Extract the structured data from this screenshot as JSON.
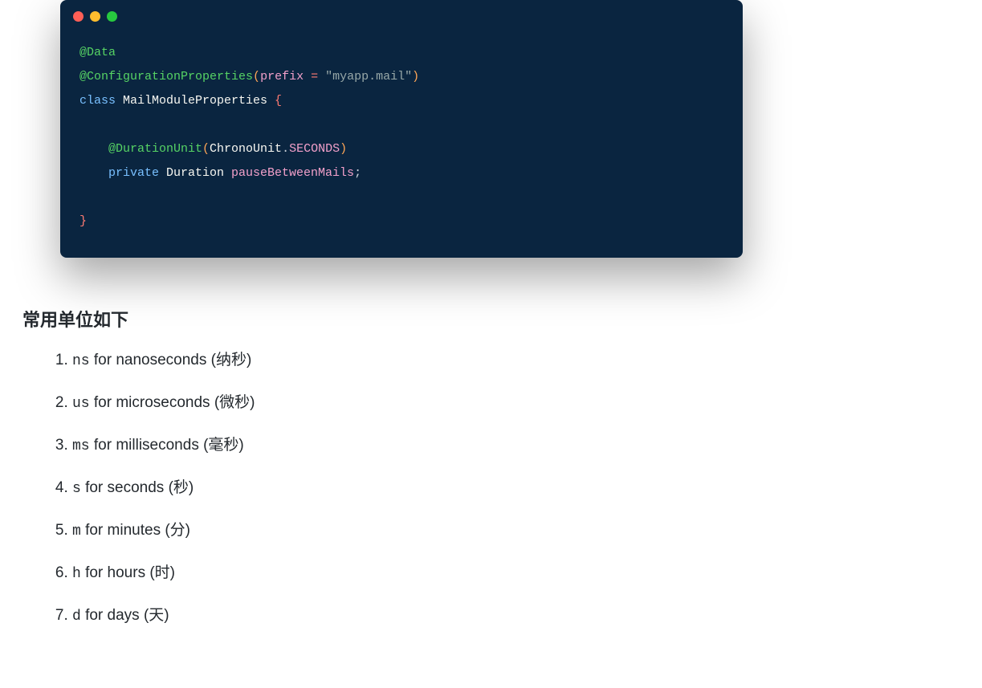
{
  "code": {
    "lines": {
      "l1_annot": "@Data",
      "l2_annot": "@ConfigurationProperties",
      "l2_p_open": "(",
      "l2_param": "prefix",
      "l2_eq": " = ",
      "l2_str": "\"myapp.mail\"",
      "l2_p_close": ")",
      "l3_kw": "class ",
      "l3_cls": "MailModuleProperties ",
      "l3_brace": "{",
      "l5_annot": "@DurationUnit",
      "l5_p_open": "(",
      "l5_arg1": "ChronoUnit",
      "l5_dot": ".",
      "l5_arg2": "SECONDS",
      "l5_p_close": ")",
      "l6_kw": "private ",
      "l6_type": "Duration ",
      "l6_ident": "pauseBetweenMails",
      "l6_semi": ";",
      "l8_brace": "}"
    }
  },
  "heading": "常用单位如下",
  "units": [
    {
      "code": "ns",
      "desc": " for nanoseconds (纳秒)"
    },
    {
      "code": "us",
      "desc": " for microseconds (微秒)"
    },
    {
      "code": "ms",
      "desc": " for milliseconds (毫秒)"
    },
    {
      "code": "s",
      "desc": " for seconds (秒)"
    },
    {
      "code": "m",
      "desc": " for minutes (分)"
    },
    {
      "code": "h",
      "desc": " for hours (时)"
    },
    {
      "code": "d",
      "desc": " for days (天)"
    }
  ]
}
